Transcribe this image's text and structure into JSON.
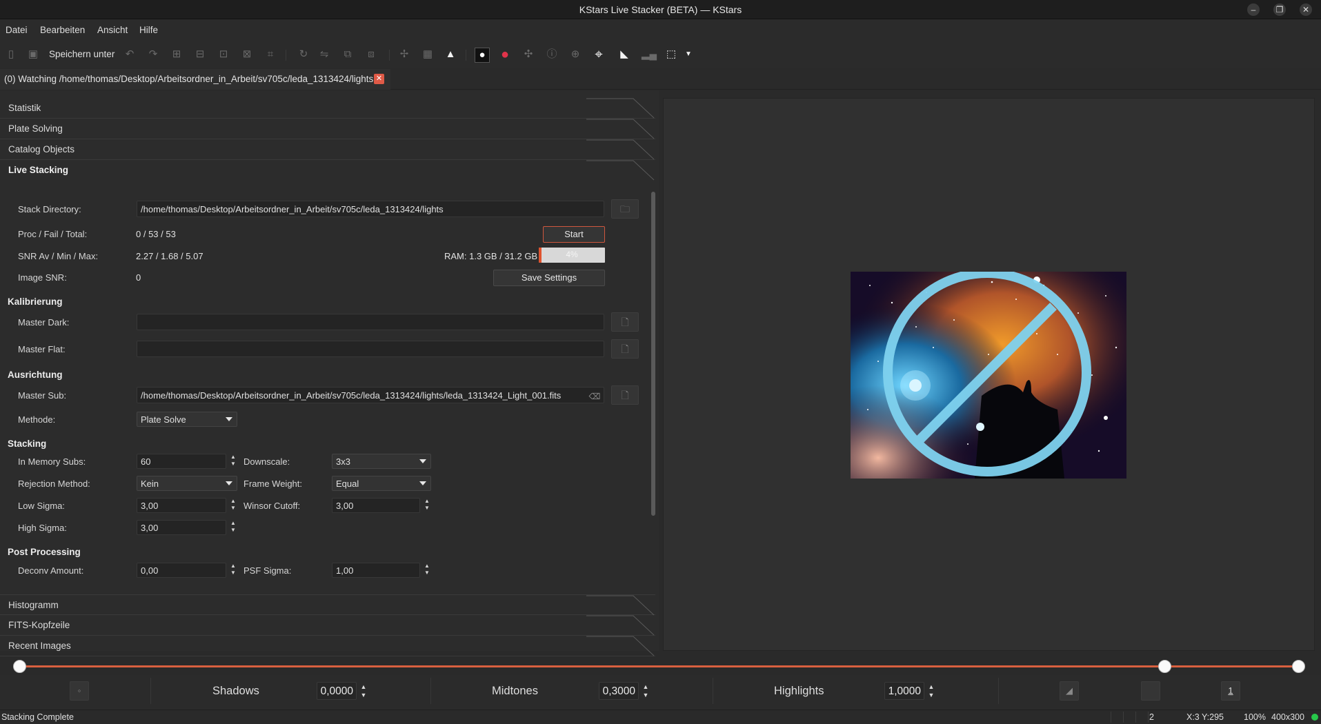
{
  "window": {
    "title": "KStars Live Stacker (BETA) — KStars"
  },
  "menu": {
    "items": [
      "Datei",
      "Bearbeiten",
      "Ansicht",
      "Hilfe"
    ]
  },
  "toolbar": {
    "save_as_label": "Speichern unter"
  },
  "tab": {
    "label": "(0) Watching /home/thomas/Desktop/Arbeitsordner_in_Arbeit/sv705c/leda_1313424/lights"
  },
  "sections": {
    "statistik": "Statistik",
    "plate_solving": "Plate Solving",
    "catalog_objects": "Catalog Objects",
    "live_stacking": "Live Stacking",
    "histogramm": "Histogramm",
    "fits_header": "FITS-Kopfzeile",
    "recent_images": "Recent Images"
  },
  "live": {
    "stack_dir_label": "Stack Directory:",
    "stack_dir_value": "/home/thomas/Desktop/Arbeitsordner_in_Arbeit/sv705c/leda_1313424/lights",
    "proc_label": "Proc / Fail / Total:",
    "proc_value": "0 / 53 / 53",
    "start_label": "Start",
    "snr_label": "SNR Av / Min / Max:",
    "snr_value": "2.27 / 1.68 / 5.07",
    "ram_label": "RAM: 1.3 GB / 31.2 GB",
    "ram_percent_text": "4%",
    "ram_fraction": 0.04,
    "image_snr_label": "Image SNR:",
    "image_snr_value": "0",
    "save_settings_label": "Save Settings"
  },
  "kalibrierung": {
    "heading": "Kalibrierung",
    "master_dark_label": "Master Dark:",
    "master_dark_value": "",
    "master_flat_label": "Master Flat:",
    "master_flat_value": ""
  },
  "ausrichtung": {
    "heading": "Ausrichtung",
    "master_sub_label": "Master Sub:",
    "master_sub_value": "/home/thomas/Desktop/Arbeitsordner_in_Arbeit/sv705c/leda_1313424/lights/leda_1313424_Light_001.fits",
    "methode_label": "Methode:",
    "methode_value": "Plate Solve"
  },
  "stacking": {
    "heading": "Stacking",
    "in_memory_label": "In Memory Subs:",
    "in_memory_value": "60",
    "downscale_label": "Downscale:",
    "downscale_value": "3x3",
    "rejection_label": "Rejection Method:",
    "rejection_value": "Kein",
    "frame_weight_label": "Frame Weight:",
    "frame_weight_value": "Equal",
    "low_sigma_label": "Low Sigma:",
    "low_sigma_value": "3,00",
    "winsor_label": "Winsor Cutoff:",
    "winsor_value": "3,00",
    "high_sigma_label": "High Sigma:",
    "high_sigma_value": "3,00"
  },
  "post": {
    "heading": "Post Processing",
    "deconv_label": "Deconv Amount:",
    "deconv_value": "0,00",
    "psf_label": "PSF Sigma:",
    "psf_value": "1,00"
  },
  "levels": {
    "shadows_label": "Shadows",
    "shadows_value": "0,0000",
    "midtones_label": "Midtones",
    "midtones_value": "0,3000",
    "highlights_label": "Highlights",
    "highlights_value": "1,0000",
    "reset_label": "1"
  },
  "status": {
    "message": "Stacking Complete",
    "frame": "2",
    "coords": "X:3 Y:295",
    "zoom": "100%",
    "size": "400x300"
  },
  "colors": {
    "accent": "#d9603f",
    "led": "#27c84a"
  },
  "icons": [
    "undo-icon",
    "redo-icon",
    "crosshair-icon",
    "record-icon",
    "star-icon",
    "folder-icon",
    "file-icon",
    "histogram-icon",
    "selection-icon"
  ]
}
